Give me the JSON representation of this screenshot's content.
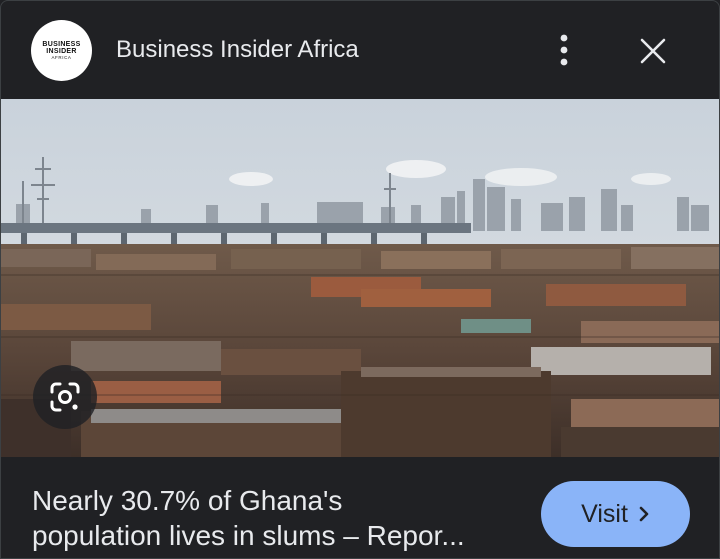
{
  "header": {
    "logo": {
      "line1": "BUSINESS",
      "line2": "INSIDER",
      "line3": "AFRICA"
    },
    "site_name": "Business Insider Africa",
    "more_icon": "more-vert-icon",
    "close_icon": "close-icon"
  },
  "image": {
    "subject": "photo",
    "lens_icon": "google-lens-icon"
  },
  "article": {
    "title_line1": "Nearly 30.7% of Ghana's",
    "title_line2": "population lives in slums – Repor..."
  },
  "actions": {
    "visit_label": "Visit",
    "visit_icon": "chevron-right-icon"
  },
  "colors": {
    "background": "#202124",
    "text": "#e8eaed",
    "accent": "#8ab4f8"
  }
}
